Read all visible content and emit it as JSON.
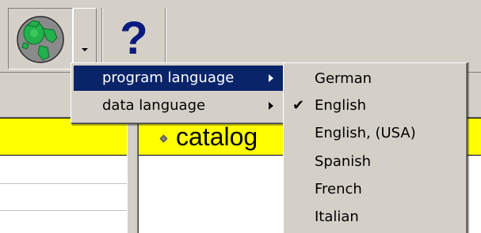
{
  "toolbar": {
    "language_button_icon": "globe-icon",
    "dropdown_icon": "chevron-down-icon",
    "help_label": "?"
  },
  "content": {
    "catalog_text": "catalog"
  },
  "menu": {
    "items": [
      {
        "label": "program language",
        "highlighted": true
      },
      {
        "label": "data language",
        "highlighted": false
      }
    ]
  },
  "submenu": {
    "items": [
      {
        "label": "German",
        "checked": false
      },
      {
        "label": "English",
        "checked": true
      },
      {
        "label": "English, (USA)",
        "checked": false
      },
      {
        "label": "Spanish",
        "checked": false
      },
      {
        "label": "French",
        "checked": false
      },
      {
        "label": "Italian",
        "checked": false
      }
    ],
    "check_mark": "✔"
  },
  "colors": {
    "menu_highlight": "#0a246a",
    "row_highlight": "#ffff00",
    "help_blue": "#0a1a7e"
  }
}
